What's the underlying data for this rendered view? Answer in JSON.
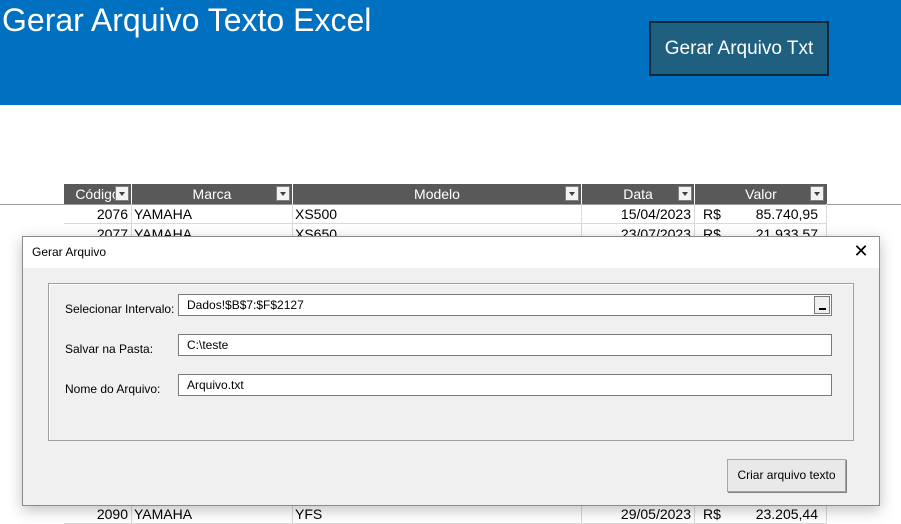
{
  "banner": {
    "title": "Gerar Arquivo Texto Excel",
    "button_label": "Gerar Arquivo Txt"
  },
  "table": {
    "headers": [
      "Código",
      "Marca",
      "Modelo",
      "Data",
      "Valor"
    ],
    "rows": [
      {
        "codigo": "2076",
        "marca": "YAMAHA",
        "modelo": "XS500",
        "data": "15/04/2023",
        "moeda": "R$",
        "valor": "85.740,95"
      },
      {
        "codigo": "2077",
        "marca": "YAMAHA",
        "modelo": "XS650",
        "data": "23/07/2023",
        "moeda": "R$",
        "valor": "21.933,57"
      },
      {
        "codigo": "2090",
        "marca": "YAMAHA",
        "modelo": "YFS",
        "data": "29/05/2023",
        "moeda": "R$",
        "valor": "23.205,44"
      }
    ]
  },
  "dialog": {
    "title": "Gerar Arquivo",
    "close_glyph": "✕",
    "range_label": "Selecionar Intervalo:",
    "range_value": "Dados!$B$7:$F$2127",
    "folder_label": "Salvar na Pasta:",
    "folder_value": "C:\\teste",
    "file_label": "Nome do Arquivo:",
    "file_value": "Arquivo.txt",
    "create_button": "Criar arquivo texto"
  },
  "colors": {
    "banner_bg": "#0070C0",
    "banner_button_bg": "#1F5F7F",
    "table_header_bg": "#595959"
  }
}
